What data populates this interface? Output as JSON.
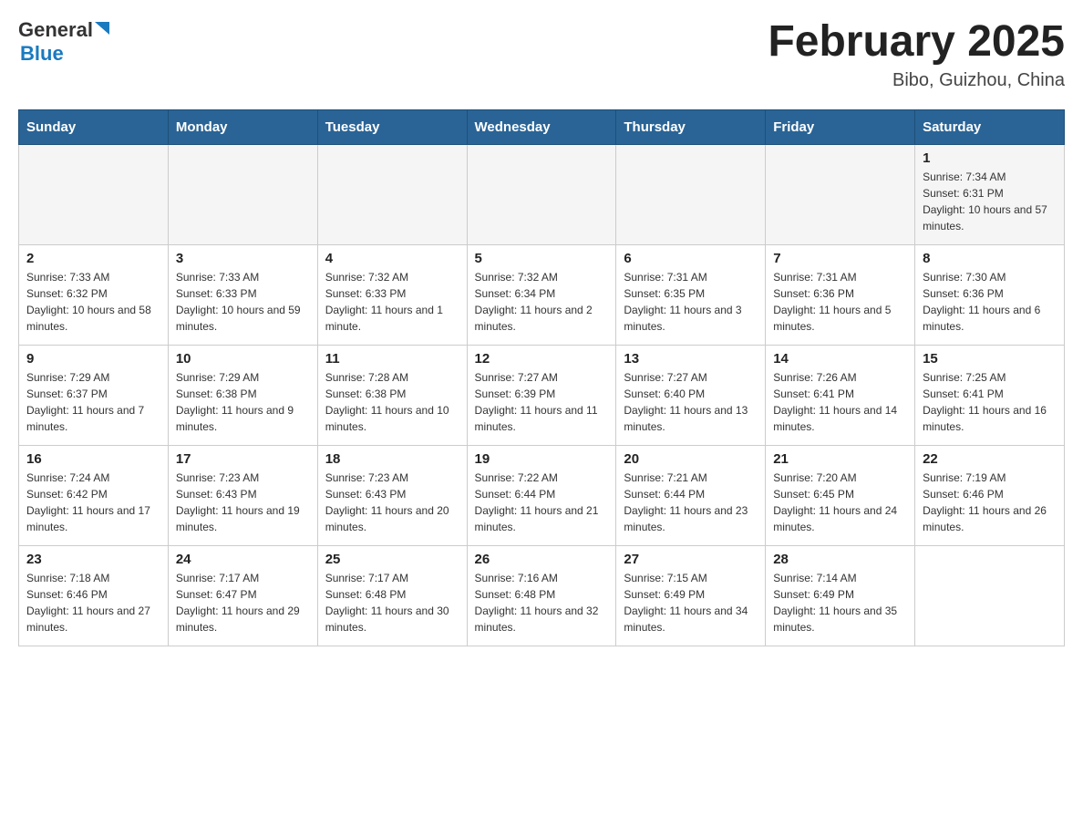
{
  "header": {
    "logo": {
      "general": "General",
      "blue": "Blue"
    },
    "title": "February 2025",
    "location": "Bibo, Guizhou, China"
  },
  "weekdays": [
    "Sunday",
    "Monday",
    "Tuesday",
    "Wednesday",
    "Thursday",
    "Friday",
    "Saturday"
  ],
  "weeks": [
    [
      {
        "day": "",
        "sunrise": "",
        "sunset": "",
        "daylight": ""
      },
      {
        "day": "",
        "sunrise": "",
        "sunset": "",
        "daylight": ""
      },
      {
        "day": "",
        "sunrise": "",
        "sunset": "",
        "daylight": ""
      },
      {
        "day": "",
        "sunrise": "",
        "sunset": "",
        "daylight": ""
      },
      {
        "day": "",
        "sunrise": "",
        "sunset": "",
        "daylight": ""
      },
      {
        "day": "",
        "sunrise": "",
        "sunset": "",
        "daylight": ""
      },
      {
        "day": "1",
        "sunrise": "Sunrise: 7:34 AM",
        "sunset": "Sunset: 6:31 PM",
        "daylight": "Daylight: 10 hours and 57 minutes."
      }
    ],
    [
      {
        "day": "2",
        "sunrise": "Sunrise: 7:33 AM",
        "sunset": "Sunset: 6:32 PM",
        "daylight": "Daylight: 10 hours and 58 minutes."
      },
      {
        "day": "3",
        "sunrise": "Sunrise: 7:33 AM",
        "sunset": "Sunset: 6:33 PM",
        "daylight": "Daylight: 10 hours and 59 minutes."
      },
      {
        "day": "4",
        "sunrise": "Sunrise: 7:32 AM",
        "sunset": "Sunset: 6:33 PM",
        "daylight": "Daylight: 11 hours and 1 minute."
      },
      {
        "day": "5",
        "sunrise": "Sunrise: 7:32 AM",
        "sunset": "Sunset: 6:34 PM",
        "daylight": "Daylight: 11 hours and 2 minutes."
      },
      {
        "day": "6",
        "sunrise": "Sunrise: 7:31 AM",
        "sunset": "Sunset: 6:35 PM",
        "daylight": "Daylight: 11 hours and 3 minutes."
      },
      {
        "day": "7",
        "sunrise": "Sunrise: 7:31 AM",
        "sunset": "Sunset: 6:36 PM",
        "daylight": "Daylight: 11 hours and 5 minutes."
      },
      {
        "day": "8",
        "sunrise": "Sunrise: 7:30 AM",
        "sunset": "Sunset: 6:36 PM",
        "daylight": "Daylight: 11 hours and 6 minutes."
      }
    ],
    [
      {
        "day": "9",
        "sunrise": "Sunrise: 7:29 AM",
        "sunset": "Sunset: 6:37 PM",
        "daylight": "Daylight: 11 hours and 7 minutes."
      },
      {
        "day": "10",
        "sunrise": "Sunrise: 7:29 AM",
        "sunset": "Sunset: 6:38 PM",
        "daylight": "Daylight: 11 hours and 9 minutes."
      },
      {
        "day": "11",
        "sunrise": "Sunrise: 7:28 AM",
        "sunset": "Sunset: 6:38 PM",
        "daylight": "Daylight: 11 hours and 10 minutes."
      },
      {
        "day": "12",
        "sunrise": "Sunrise: 7:27 AM",
        "sunset": "Sunset: 6:39 PM",
        "daylight": "Daylight: 11 hours and 11 minutes."
      },
      {
        "day": "13",
        "sunrise": "Sunrise: 7:27 AM",
        "sunset": "Sunset: 6:40 PM",
        "daylight": "Daylight: 11 hours and 13 minutes."
      },
      {
        "day": "14",
        "sunrise": "Sunrise: 7:26 AM",
        "sunset": "Sunset: 6:41 PM",
        "daylight": "Daylight: 11 hours and 14 minutes."
      },
      {
        "day": "15",
        "sunrise": "Sunrise: 7:25 AM",
        "sunset": "Sunset: 6:41 PM",
        "daylight": "Daylight: 11 hours and 16 minutes."
      }
    ],
    [
      {
        "day": "16",
        "sunrise": "Sunrise: 7:24 AM",
        "sunset": "Sunset: 6:42 PM",
        "daylight": "Daylight: 11 hours and 17 minutes."
      },
      {
        "day": "17",
        "sunrise": "Sunrise: 7:23 AM",
        "sunset": "Sunset: 6:43 PM",
        "daylight": "Daylight: 11 hours and 19 minutes."
      },
      {
        "day": "18",
        "sunrise": "Sunrise: 7:23 AM",
        "sunset": "Sunset: 6:43 PM",
        "daylight": "Daylight: 11 hours and 20 minutes."
      },
      {
        "day": "19",
        "sunrise": "Sunrise: 7:22 AM",
        "sunset": "Sunset: 6:44 PM",
        "daylight": "Daylight: 11 hours and 21 minutes."
      },
      {
        "day": "20",
        "sunrise": "Sunrise: 7:21 AM",
        "sunset": "Sunset: 6:44 PM",
        "daylight": "Daylight: 11 hours and 23 minutes."
      },
      {
        "day": "21",
        "sunrise": "Sunrise: 7:20 AM",
        "sunset": "Sunset: 6:45 PM",
        "daylight": "Daylight: 11 hours and 24 minutes."
      },
      {
        "day": "22",
        "sunrise": "Sunrise: 7:19 AM",
        "sunset": "Sunset: 6:46 PM",
        "daylight": "Daylight: 11 hours and 26 minutes."
      }
    ],
    [
      {
        "day": "23",
        "sunrise": "Sunrise: 7:18 AM",
        "sunset": "Sunset: 6:46 PM",
        "daylight": "Daylight: 11 hours and 27 minutes."
      },
      {
        "day": "24",
        "sunrise": "Sunrise: 7:17 AM",
        "sunset": "Sunset: 6:47 PM",
        "daylight": "Daylight: 11 hours and 29 minutes."
      },
      {
        "day": "25",
        "sunrise": "Sunrise: 7:17 AM",
        "sunset": "Sunset: 6:48 PM",
        "daylight": "Daylight: 11 hours and 30 minutes."
      },
      {
        "day": "26",
        "sunrise": "Sunrise: 7:16 AM",
        "sunset": "Sunset: 6:48 PM",
        "daylight": "Daylight: 11 hours and 32 minutes."
      },
      {
        "day": "27",
        "sunrise": "Sunrise: 7:15 AM",
        "sunset": "Sunset: 6:49 PM",
        "daylight": "Daylight: 11 hours and 34 minutes."
      },
      {
        "day": "28",
        "sunrise": "Sunrise: 7:14 AM",
        "sunset": "Sunset: 6:49 PM",
        "daylight": "Daylight: 11 hours and 35 minutes."
      },
      {
        "day": "",
        "sunrise": "",
        "sunset": "",
        "daylight": ""
      }
    ]
  ]
}
